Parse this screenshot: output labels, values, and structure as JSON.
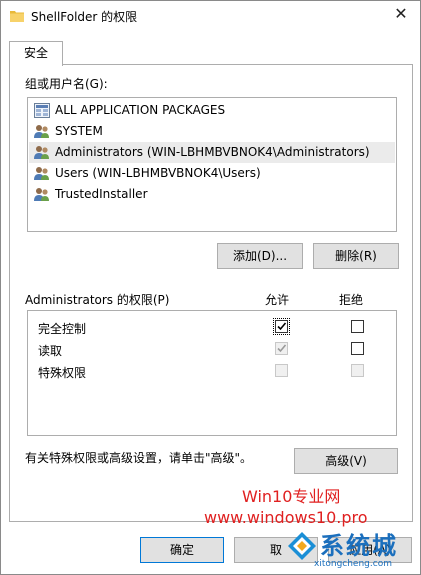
{
  "window": {
    "title": "ShellFolder 的权限",
    "close_glyph": "✕"
  },
  "tab": {
    "label": "安全"
  },
  "groups": {
    "label": "组或用户名(G):",
    "items": [
      {
        "name": "ALL APPLICATION PACKAGES",
        "icon": "app-packages-icon"
      },
      {
        "name": "SYSTEM",
        "icon": "users-icon"
      },
      {
        "name": "Administrators (WIN-LBHMBVBNOK4\\Administrators)",
        "icon": "users-icon",
        "selected": true
      },
      {
        "name": "Users (WIN-LBHMBVBNOK4\\Users)",
        "icon": "users-icon"
      },
      {
        "name": "TrustedInstaller",
        "icon": "users-icon"
      }
    ]
  },
  "buttons": {
    "add": "添加(D)...",
    "remove": "删除(R)",
    "advanced": "高级(V)",
    "ok": "确定",
    "cancel": "取",
    "apply": "应用(A)"
  },
  "permissions": {
    "label": "Administrators 的权限(P)",
    "allow_header": "允许",
    "deny_header": "拒绝",
    "rows": [
      {
        "name": "完全控制",
        "allow": true,
        "allow_disabled": false,
        "deny": false,
        "deny_disabled": false
      },
      {
        "name": "读取",
        "allow": true,
        "allow_disabled": true,
        "deny": false,
        "deny_disabled": false
      },
      {
        "name": "特殊权限",
        "allow": false,
        "allow_disabled": true,
        "deny": false,
        "deny_disabled": true
      }
    ]
  },
  "advanced_note": "有关特殊权限或高级设置，请单击\"高级\"。",
  "watermark": {
    "line1": "Win10专业网",
    "line2": "www.windows10.pro",
    "logo_text": "系统城",
    "logo_url": "xitongcheng.com",
    "color": "#e02020"
  }
}
